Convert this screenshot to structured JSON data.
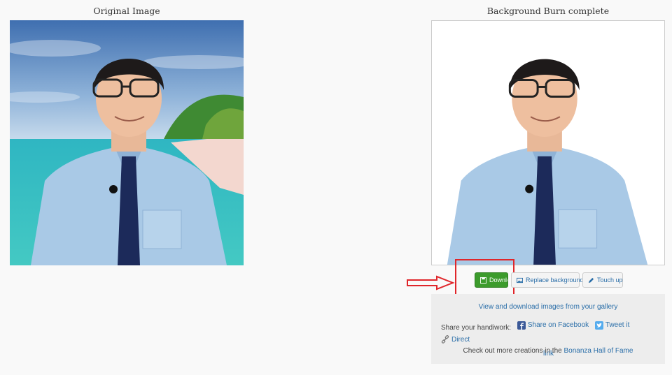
{
  "original": {
    "title": "Original Image"
  },
  "result": {
    "title": "Background Burn complete"
  },
  "buttons": {
    "download": "Download",
    "replace": "Replace background",
    "touch_up": "Touch up"
  },
  "share": {
    "gallery_link": "View and download images from your gallery",
    "label": "Share your handiwork:",
    "facebook": "Share on Facebook",
    "twitter": "Tweet it",
    "direct_part1": "Direct",
    "direct_part2": "link",
    "hall_prefix": "Check out more creations in the",
    "hall_link": "Bonanza Hall of Fame"
  },
  "colors": {
    "download_green": "#3c9b2c",
    "link_blue": "#2a6ea8",
    "highlight_red": "#e0262b",
    "panel_gray": "#ededed"
  },
  "icons": {
    "download": "floppy-disk-icon",
    "replace": "image-icon",
    "touch_up": "pencil-icon",
    "facebook": "facebook-icon",
    "twitter": "twitter-icon",
    "direct": "link-icon"
  }
}
